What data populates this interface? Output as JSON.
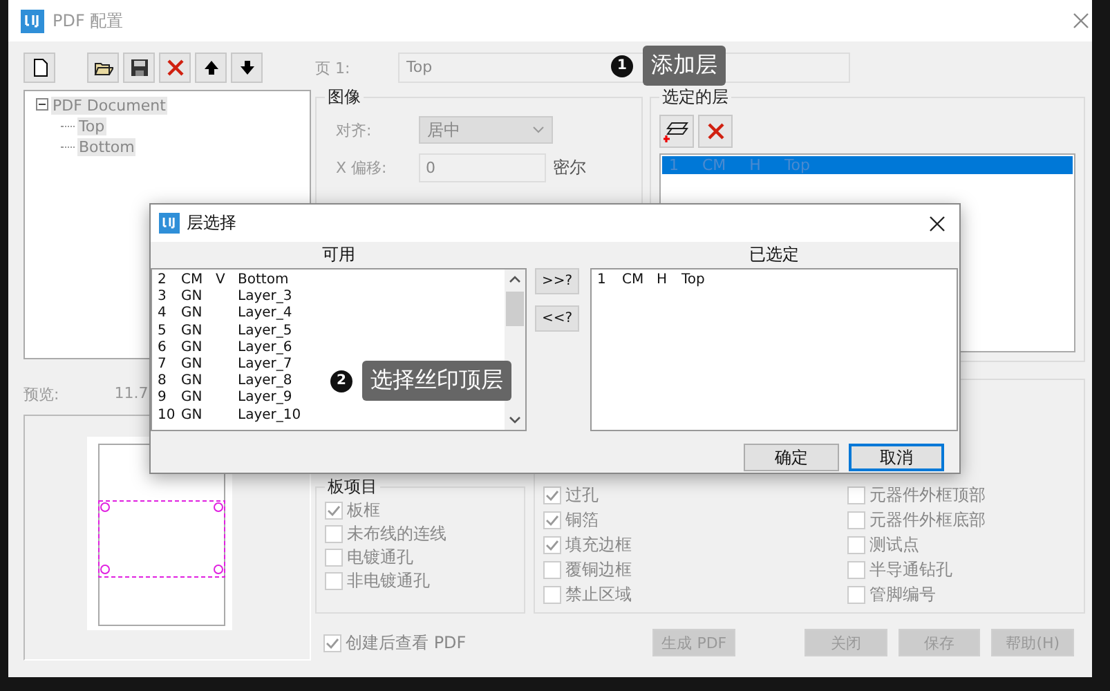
{
  "window": {
    "title": "PDF 配置"
  },
  "toolbar": [
    {
      "kind": "new"
    },
    {
      "kind": "open"
    },
    {
      "kind": "save"
    },
    {
      "kind": "delete"
    },
    {
      "kind": "up"
    },
    {
      "kind": "down"
    }
  ],
  "page": {
    "label": "页 1:",
    "value": "Top"
  },
  "tree": [
    {
      "label": "PDF Document",
      "expanded": true,
      "children": [
        {
          "label": "Top"
        },
        {
          "label": "Bottom"
        }
      ]
    }
  ],
  "image_group": {
    "title": "图像",
    "align_label": "对齐:",
    "align_value": "居中",
    "x_label": "X 偏移:",
    "x_value": "0",
    "x_unit": "密尔"
  },
  "selected_layers": {
    "title": "选定的层",
    "rows": [
      {
        "cells": [
          "1",
          "CM",
          "H",
          "Top"
        ],
        "selected": true
      }
    ]
  },
  "preview": {
    "label": "预览:",
    "size": "11.7"
  },
  "board_items": {
    "title": "板项目",
    "items": [
      {
        "label": "板框",
        "checked": true
      },
      {
        "label": "未布线的连线",
        "checked": false
      },
      {
        "label": "电镀通孔",
        "checked": false
      },
      {
        "label": "非电镀通孔",
        "checked": false
      }
    ]
  },
  "layer_items": [
    {
      "label": "过孔",
      "checked": true
    },
    {
      "label": "元器件外框顶部",
      "checked": false
    },
    {
      "label": "铜箔",
      "checked": true
    },
    {
      "label": "元器件外框底部",
      "checked": false
    },
    {
      "label": "填充边框",
      "checked": true
    },
    {
      "label": "测试点",
      "checked": false
    },
    {
      "label": "覆铜边框",
      "checked": false
    },
    {
      "label": "半导通钻孔",
      "checked": false
    },
    {
      "label": "禁止区域",
      "checked": false
    },
    {
      "label": "管脚编号",
      "checked": false
    }
  ],
  "view_after": {
    "label": "创建后查看 PDF",
    "checked": true
  },
  "buttons": [
    "生成 PDF",
    "关闭",
    "保存",
    "帮助(H)"
  ],
  "dialog": {
    "title": "层选择",
    "available_title": "可用",
    "selected_title": "已选定",
    "available": [
      {
        "num": "2",
        "type": "CM",
        "dir": "V",
        "name": "Bottom"
      },
      {
        "num": "3",
        "type": "GN",
        "name": "Layer_3"
      },
      {
        "num": "4",
        "type": "GN",
        "name": "Layer_4"
      },
      {
        "num": "5",
        "type": "GN",
        "name": "Layer_5"
      },
      {
        "num": "6",
        "type": "GN",
        "name": "Layer_6"
      },
      {
        "num": "7",
        "type": "GN",
        "name": "Layer_7"
      },
      {
        "num": "8",
        "type": "GN",
        "name": "Layer_8"
      },
      {
        "num": "9",
        "type": "GN",
        "name": "Layer_9"
      },
      {
        "num": "10",
        "type": "GN",
        "name": "Layer_10"
      }
    ],
    "selected": [
      {
        "num": "1",
        "type": "CM",
        "dir": "H",
        "name": "Top"
      }
    ],
    "add_button": ">>?",
    "remove_button": "<<?",
    "ok": "确定",
    "cancel": "取消"
  },
  "callouts": [
    {
      "number": "1",
      "text": "添加层"
    },
    {
      "number": "2",
      "text": "选择丝印顶层"
    }
  ]
}
